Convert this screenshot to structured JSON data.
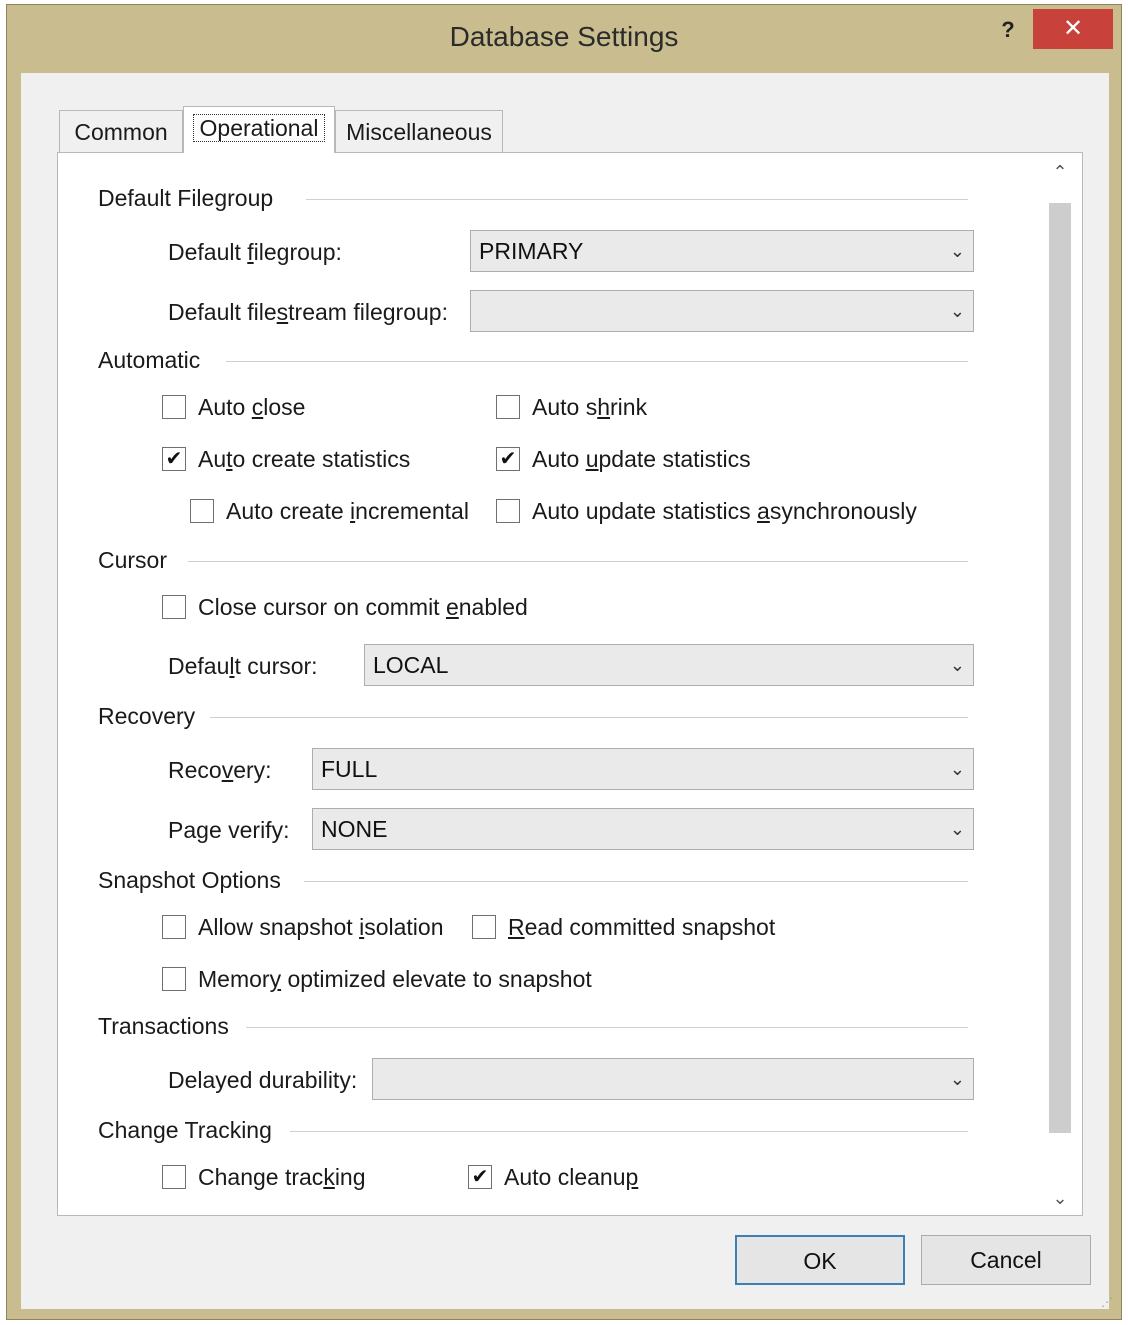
{
  "window": {
    "title": "Database Settings",
    "help": "?",
    "close": "✕"
  },
  "tabs": [
    {
      "label": "Common"
    },
    {
      "label": "Operational"
    },
    {
      "label": "Miscellaneous"
    }
  ],
  "sections": {
    "default_filegroup": {
      "title": "Default Filegroup",
      "filegroup": {
        "label_a": "Default ",
        "label_u": "f",
        "label_b": "ilegroup:",
        "value": "PRIMARY"
      },
      "filestream": {
        "label_a": "Default file",
        "label_u": "s",
        "label_b": "tream filegroup:",
        "value": ""
      }
    },
    "automatic": {
      "title": "Automatic",
      "auto_close": {
        "a": "Auto ",
        "u": "c",
        "b": "lose",
        "checked": false
      },
      "auto_shrink": {
        "a": "Auto s",
        "u": "h",
        "b": "rink",
        "checked": false
      },
      "auto_create_stats": {
        "a": "Au",
        "u": "t",
        "b": "o create statistics",
        "checked": true
      },
      "auto_update_stats": {
        "a": "Auto ",
        "u": "u",
        "b": "pdate statistics",
        "checked": true
      },
      "auto_create_incremental": {
        "a": "Auto create ",
        "u": "i",
        "b": "ncremental",
        "checked": false
      },
      "auto_update_async": {
        "a": "Auto update statistics ",
        "u": "a",
        "b": "synchronously",
        "checked": false
      }
    },
    "cursor": {
      "title": "Cursor",
      "close_on_commit": {
        "a": "Close cursor on commit ",
        "u": "e",
        "b": "nabled",
        "checked": false
      },
      "default_cursor": {
        "label_a": "Defau",
        "label_u": "l",
        "label_b": "t cursor:",
        "value": "LOCAL"
      }
    },
    "recovery": {
      "title": "Recovery",
      "recovery": {
        "label_a": "Reco",
        "label_u": "v",
        "label_b": "ery:",
        "value": "FULL"
      },
      "page_verify": {
        "label_a": "Pa",
        "label_u": "g",
        "label_b": "e verify:",
        "value": "NONE"
      }
    },
    "snapshot": {
      "title": "Snapshot Options",
      "allow_isolation": {
        "a": "Allow snapshot ",
        "u": "i",
        "b": "solation",
        "checked": false
      },
      "read_committed": {
        "a": "",
        "u": "R",
        "b": "ead committed snapshot",
        "checked": false
      },
      "memory_optimized": {
        "a": "Memor",
        "u": "y",
        "b": " optimized elevate to snapshot",
        "checked": false
      }
    },
    "transactions": {
      "title": "Transactions",
      "delayed_durability": {
        "label": "Delayed durability:",
        "value": ""
      }
    },
    "change_tracking": {
      "title": "Change Tracking",
      "change_tracking": {
        "a": "Change trac",
        "u": "k",
        "b": "ing",
        "checked": false
      },
      "auto_cleanup": {
        "a": "Auto cleanu",
        "u": "p",
        "b": "",
        "checked": true
      }
    }
  },
  "buttons": {
    "ok": "OK",
    "cancel": "Cancel"
  },
  "glyphs": {
    "check": "✔",
    "combo_arrow": "⌄",
    "scroll_up": "⌃",
    "scroll_down": "⌄"
  }
}
